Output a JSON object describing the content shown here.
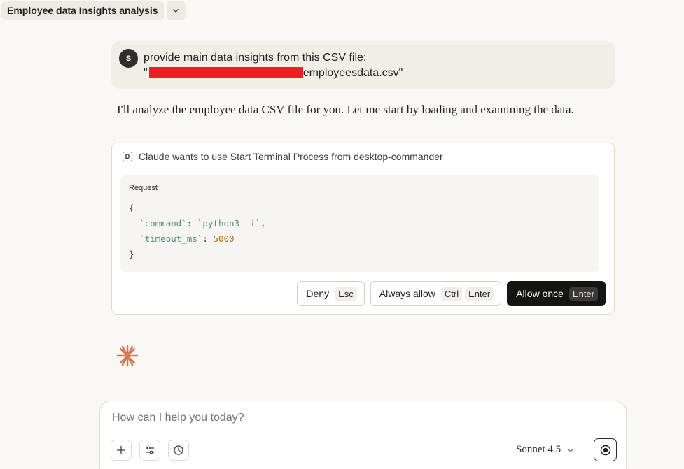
{
  "header": {
    "title": "Employee data Insights analysis"
  },
  "user_message": {
    "avatar_initial": "S",
    "line1": "provide main data insights from this CSV file:",
    "line2_prefix": "\"",
    "line2_suffix": "employeesdata.csv\""
  },
  "assistant": {
    "text": "I'll analyze the employee data CSV file for you. Let me start by loading and examining the data."
  },
  "tool_request": {
    "badge": "D",
    "header": "Claude wants to use Start Terminal Process from desktop-commander",
    "request_label": "Request",
    "open_brace": "{",
    "close_brace": "}",
    "command_key": "`command`",
    "command_value": "`python3 -i`",
    "timeout_key": "`timeout_ms`",
    "timeout_value": "5000",
    "deny": {
      "label": "Deny",
      "kbd": "Esc"
    },
    "always_allow": {
      "label": "Always allow",
      "kbd1": "Ctrl",
      "kbd2": "Enter"
    },
    "allow_once": {
      "label": "Allow once",
      "kbd": "Enter"
    }
  },
  "composer": {
    "placeholder": "How can I help you today?",
    "model": "Sonnet 4.5"
  },
  "colors": {
    "accent_spark": "#d97757",
    "redaction": "#ee1c24",
    "code_key": "#4a8e74",
    "code_number": "#b86a14"
  }
}
